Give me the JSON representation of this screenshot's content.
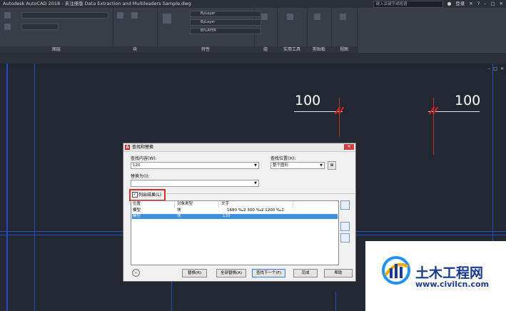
{
  "window": {
    "title": "Autodesk AutoCAD 2018 - 未注册版    Data Extraction and Multileaders Sample.dwg",
    "search_placeholder": "键入关键字或短语",
    "user": "登录"
  },
  "ribbon": {
    "groups": [
      "图层",
      "块",
      "特性",
      "组",
      "实用工具",
      "剪贴板",
      "视图"
    ],
    "bylayer1": "ByLayer",
    "bylayer2": "ByLayer",
    "bylayer3": "BYLAYER"
  },
  "canvas": {
    "dim_left": "100",
    "dim_right": "100"
  },
  "dialog": {
    "title": "查找和替换",
    "find_label": "查找内容(W):",
    "find_value": "120",
    "location_label": "查找位置(H):",
    "location_value": "整个图形",
    "replace_label": "替换为(I):",
    "replace_value": "",
    "list_results_label": "列出结果(L)",
    "list_results_checked": true,
    "columns": [
      "位置",
      "对象类型",
      "文字"
    ],
    "rows": [
      {
        "location": "模型",
        "type": "块",
        "text": "1680 ‰2   300 ‰2 1200 ‰2",
        "selected": false
      },
      {
        "location": "模型",
        "type": "块",
        "text": "120",
        "selected": true
      }
    ],
    "buttons": {
      "replace": "替换(R)",
      "replace_all": "全部替换(A)",
      "find_next": "查找下一个(F)",
      "done": "完成",
      "help": "帮助"
    }
  },
  "watermark": {
    "name": "土木工程网",
    "url": "www.civilcn.com"
  }
}
